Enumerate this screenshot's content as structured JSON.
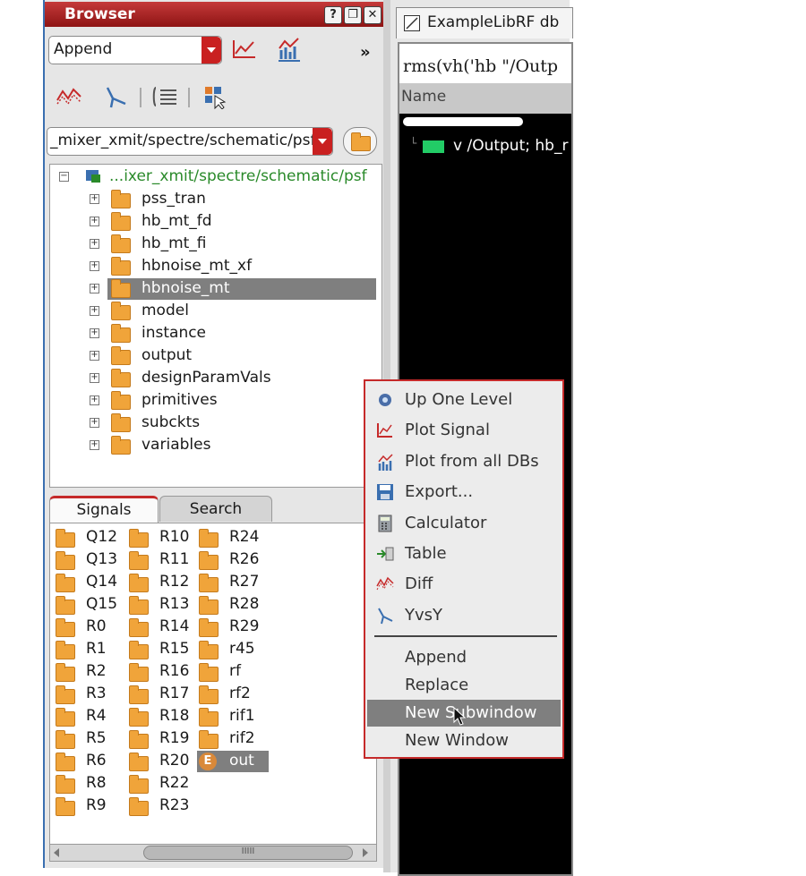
{
  "browser": {
    "title": "Browser",
    "mode_value": "Append",
    "more_label": "»",
    "path_value": "_mixer_xmit/spectre/schematic/psf",
    "tree_root": "...ixer_xmit/spectre/schematic/psf",
    "tree_items": [
      "pss_tran",
      "hb_mt_fd",
      "hb_mt_fi",
      "hbnoise_mt_xf",
      "hbnoise_mt",
      "model",
      "instance",
      "output",
      "designParamVals",
      "primitives",
      "subckts",
      "variables"
    ],
    "selected_item": "hbnoise_mt",
    "tabs": [
      "Signals",
      "Search"
    ],
    "signals_col1": [
      "Q12",
      "Q13",
      "Q14",
      "Q15",
      "R0",
      "R1",
      "R2",
      "R3",
      "R4",
      "R5",
      "R6",
      "R8",
      "R9"
    ],
    "signals_col2": [
      "R10",
      "R11",
      "R12",
      "R13",
      "R14",
      "R15",
      "R16",
      "R17",
      "R18",
      "R19",
      "R20",
      "R22",
      "R23"
    ],
    "signals_col3": [
      "R24",
      "R26",
      "R27",
      "R28",
      "R29",
      "r45",
      "rf",
      "rf2",
      "rif1",
      "rif2",
      "out"
    ],
    "selected_signal": "out",
    "scroll_grip": "IIIII"
  },
  "right": {
    "tab_label": "ExampleLibRF db",
    "expression": "rms(vh('hb \"/Outp",
    "column_header": "Name",
    "signal_entry": "v /Output; hb_r",
    "signal_color": "#22cc66"
  },
  "menu": {
    "items": [
      {
        "label": "Up One Level",
        "icon": "up-level-icon"
      },
      {
        "label": "Plot Signal",
        "icon": "plot-signal-icon"
      },
      {
        "label": "Plot from all DBs",
        "icon": "plot-all-dbs-icon"
      },
      {
        "label": "Export...",
        "icon": "export-icon"
      },
      {
        "label": "Calculator",
        "icon": "calculator-icon"
      },
      {
        "label": "Table",
        "icon": "table-icon"
      },
      {
        "label": "Diff",
        "icon": "diff-icon"
      },
      {
        "label": "YvsY",
        "icon": "yvsy-icon"
      }
    ],
    "sub_items": [
      "Append",
      "Replace",
      "New Subwindow",
      "New Window"
    ],
    "highlighted": "New Subwindow"
  },
  "colors": {
    "accent": "#c52a2a",
    "selection": "#7f7f7f",
    "tree_root": "#2a8a2a"
  }
}
